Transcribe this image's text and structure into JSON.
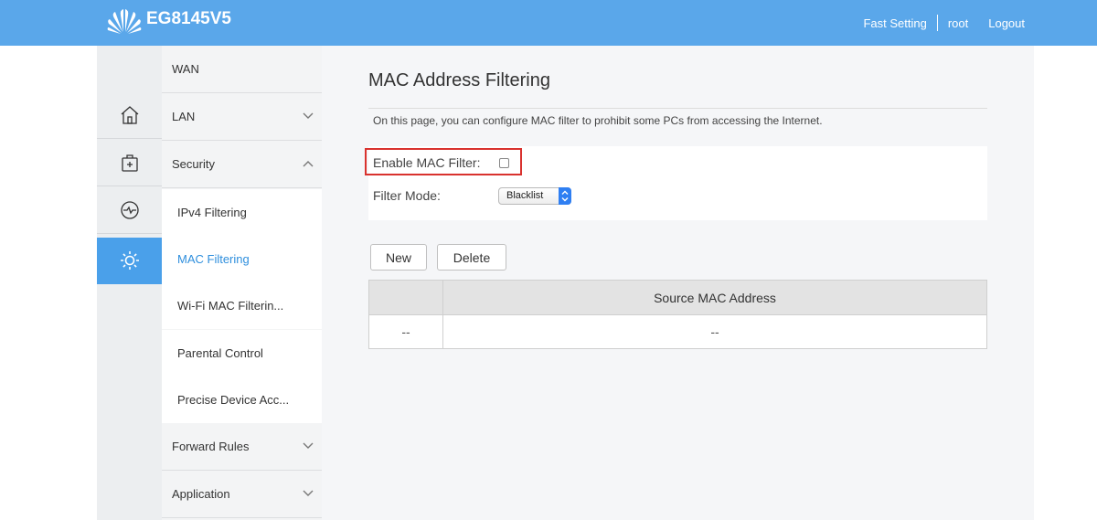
{
  "header": {
    "logo_icon": "huawei-logo",
    "model": "EG8145V5",
    "links": [
      "Fast Setting",
      "root",
      "Logout"
    ]
  },
  "icon_sidebar": [
    {
      "name": "home-icon"
    },
    {
      "name": "toolbox-icon"
    },
    {
      "name": "diagnose-icon"
    },
    {
      "name": "settings-icon",
      "active": true
    }
  ],
  "menu": {
    "wan": "WAN",
    "lan": "LAN",
    "security": "Security",
    "sub": [
      "IPv4 Filtering",
      "MAC Filtering",
      "Wi-Fi MAC Filterin...",
      "Parental Control",
      "Precise Device Acc..."
    ],
    "forward_rules": "Forward Rules",
    "application": "Application"
  },
  "page": {
    "title": "MAC Address Filtering",
    "description": "On this page, you can configure MAC filter to prohibit some PCs from accessing the Internet.",
    "enable_label": "Enable MAC Filter:",
    "enable_checked": false,
    "filter_mode_label": "Filter Mode:",
    "filter_mode_value": "Blacklist",
    "new_label": "New",
    "delete_label": "Delete"
  },
  "table": {
    "headers": [
      "",
      "Source MAC Address"
    ],
    "rows": [
      [
        "--",
        "--"
      ]
    ]
  },
  "colors": {
    "topbar": "#5aa7ea",
    "active_icon": "#4aa0ea",
    "active_menu_text": "#2f8fdd",
    "highlight_border": "#d9322e"
  }
}
